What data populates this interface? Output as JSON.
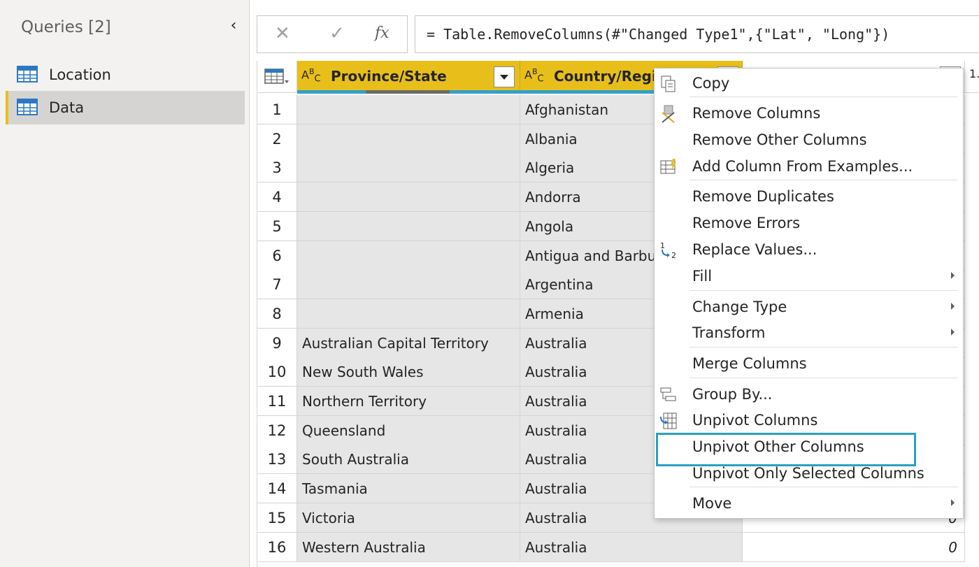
{
  "queries_pane": {
    "title": "Queries [2]",
    "items": [
      {
        "label": "Location",
        "selected": false
      },
      {
        "label": "Data",
        "selected": true
      }
    ]
  },
  "formula_bar": {
    "fx_label": "fx",
    "formula": "= Table.RemoveColumns(#\"Changed Type1\",{\"Lat\", \"Long\"})"
  },
  "grid": {
    "columns": [
      {
        "type": "ABC",
        "name": "Province/State"
      },
      {
        "type": "ABC",
        "name": "Country/Region"
      },
      {
        "type": "1.2",
        "name": ""
      },
      {
        "type": "1.2",
        "name": ""
      }
    ],
    "rows": [
      {
        "n": "1",
        "province": "",
        "country": "Afghanistan",
        "value": ""
      },
      {
        "n": "2",
        "province": "",
        "country": "Albania",
        "value": ""
      },
      {
        "n": "3",
        "province": "",
        "country": "Algeria",
        "value": ""
      },
      {
        "n": "4",
        "province": "",
        "country": "Andorra",
        "value": ""
      },
      {
        "n": "5",
        "province": "",
        "country": "Angola",
        "value": ""
      },
      {
        "n": "6",
        "province": "",
        "country": "Antigua and Barbuda",
        "value": ""
      },
      {
        "n": "7",
        "province": "",
        "country": "Argentina",
        "value": ""
      },
      {
        "n": "8",
        "province": "",
        "country": "Armenia",
        "value": ""
      },
      {
        "n": "9",
        "province": "Australian Capital Territory",
        "country": "Australia",
        "value": ""
      },
      {
        "n": "10",
        "province": "New South Wales",
        "country": "Australia",
        "value": ""
      },
      {
        "n": "11",
        "province": "Northern Territory",
        "country": "Australia",
        "value": ""
      },
      {
        "n": "12",
        "province": "Queensland",
        "country": "Australia",
        "value": ""
      },
      {
        "n": "13",
        "province": "South Australia",
        "country": "Australia",
        "value": ""
      },
      {
        "n": "14",
        "province": "Tasmania",
        "country": "Australia",
        "value": ""
      },
      {
        "n": "15",
        "province": "Victoria",
        "country": "Australia",
        "value": "0"
      },
      {
        "n": "16",
        "province": "Western Australia",
        "country": "Australia",
        "value": "0"
      }
    ]
  },
  "context_menu": {
    "items": [
      {
        "label": "Copy",
        "icon": "copy-icon",
        "submenu": false
      },
      {
        "label": "Remove Columns",
        "icon": "remove-columns-icon",
        "submenu": false
      },
      {
        "label": "Remove Other Columns",
        "icon": "",
        "submenu": false
      },
      {
        "label": "Add Column From Examples...",
        "icon": "column-from-examples-icon",
        "submenu": false
      },
      {
        "label": "Remove Duplicates",
        "icon": "",
        "submenu": false
      },
      {
        "label": "Remove Errors",
        "icon": "",
        "submenu": false
      },
      {
        "label": "Replace Values...",
        "icon": "replace-values-icon",
        "submenu": false
      },
      {
        "label": "Fill",
        "icon": "",
        "submenu": true
      },
      {
        "label": "Change Type",
        "icon": "",
        "submenu": true
      },
      {
        "label": "Transform",
        "icon": "",
        "submenu": true
      },
      {
        "label": "Merge Columns",
        "icon": "",
        "submenu": false
      },
      {
        "label": "Group By...",
        "icon": "group-by-icon",
        "submenu": false
      },
      {
        "label": "Unpivot Columns",
        "icon": "unpivot-icon",
        "submenu": false
      },
      {
        "label": "Unpivot Other Columns",
        "icon": "",
        "submenu": false,
        "highlighted": true
      },
      {
        "label": "Unpivot Only Selected Columns",
        "icon": "",
        "submenu": false
      },
      {
        "label": "Move",
        "icon": "",
        "submenu": true
      }
    ]
  },
  "colors": {
    "header_accent": "#e8bf1a",
    "highlight_border": "#2aa0c0",
    "selected_column_bg": "#e6e6e6",
    "quality_bar": "#33a1c9"
  }
}
